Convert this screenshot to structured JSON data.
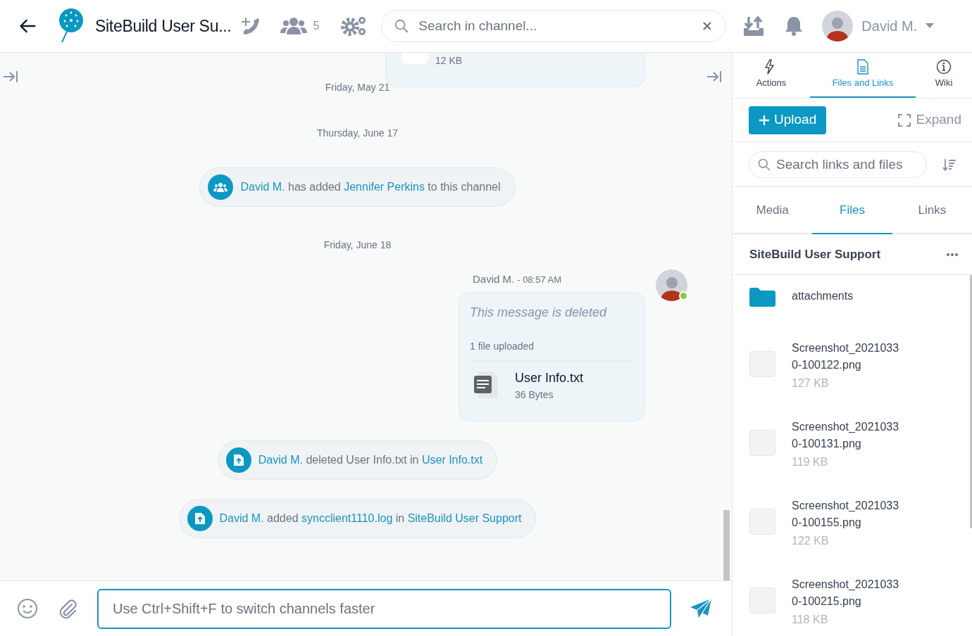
{
  "header": {
    "title": "SiteBuild User Su...",
    "member_count": "5",
    "search_placeholder": "Search in channel...",
    "user_name": "David M."
  },
  "chat": {
    "top_file_size": "12 KB",
    "items": [
      {
        "kind": "date",
        "text": "Friday, May 21"
      },
      {
        "kind": "date",
        "text": "Thursday, June 17"
      },
      {
        "kind": "event",
        "parts": [
          {
            "kind": "link",
            "text": "David M."
          },
          {
            "kind": "plain",
            "text": " has added "
          },
          {
            "kind": "link",
            "text": "Jennifer Perkins"
          },
          {
            "kind": "plain",
            "text": " to this channel"
          }
        ]
      },
      {
        "kind": "date",
        "text": "Friday, June 18"
      },
      {
        "kind": "message",
        "author": "David M.",
        "time": "- 08:57 AM",
        "online": true,
        "deleted_text": "This message is deleted",
        "files_caption": "1 file uploaded",
        "file_name": "User Info.txt",
        "file_size": "36 Bytes"
      },
      {
        "kind": "event",
        "parts": [
          {
            "kind": "link",
            "text": "David M."
          },
          {
            "kind": "plain",
            "text": " deleted User Info.txt in "
          },
          {
            "kind": "link",
            "text": "User Info.txt"
          }
        ]
      },
      {
        "kind": "event",
        "parts": [
          {
            "kind": "link",
            "text": "David M."
          },
          {
            "kind": "plain",
            "text": " added "
          },
          {
            "kind": "link",
            "text": "syncclient1110.log"
          },
          {
            "kind": "plain",
            "text": " in "
          },
          {
            "kind": "link",
            "text": "SiteBuild User Support"
          }
        ]
      }
    ],
    "composer_placeholder": "Use Ctrl+Shift+F to switch channels faster"
  },
  "panel": {
    "tabs": [
      {
        "label": "Actions",
        "selected": false
      },
      {
        "label": "Files and Links",
        "selected": true
      },
      {
        "label": "Wiki",
        "selected": false
      }
    ],
    "upload_label": "Upload",
    "expand_label": "Expand",
    "search_placeholder": "Search links and files",
    "subtabs": [
      {
        "label": "Media",
        "selected": false
      },
      {
        "label": "Files",
        "selected": true
      },
      {
        "label": "Links",
        "selected": false
      }
    ],
    "folder_title": "SiteBuild User Support",
    "files": [
      {
        "kind": "folder",
        "name": "attachments"
      },
      {
        "kind": "image",
        "name": "Screenshot_20210330-100122.png",
        "size": "127 KB"
      },
      {
        "kind": "image",
        "name": "Screenshot_20210330-100131.png",
        "size": "119 KB"
      },
      {
        "kind": "image",
        "name": "Screenshot_20210330-100155.png",
        "size": "122 KB"
      },
      {
        "kind": "image",
        "name": "Screenshot_20210330-100215.png",
        "size": "118 KB"
      }
    ]
  }
}
